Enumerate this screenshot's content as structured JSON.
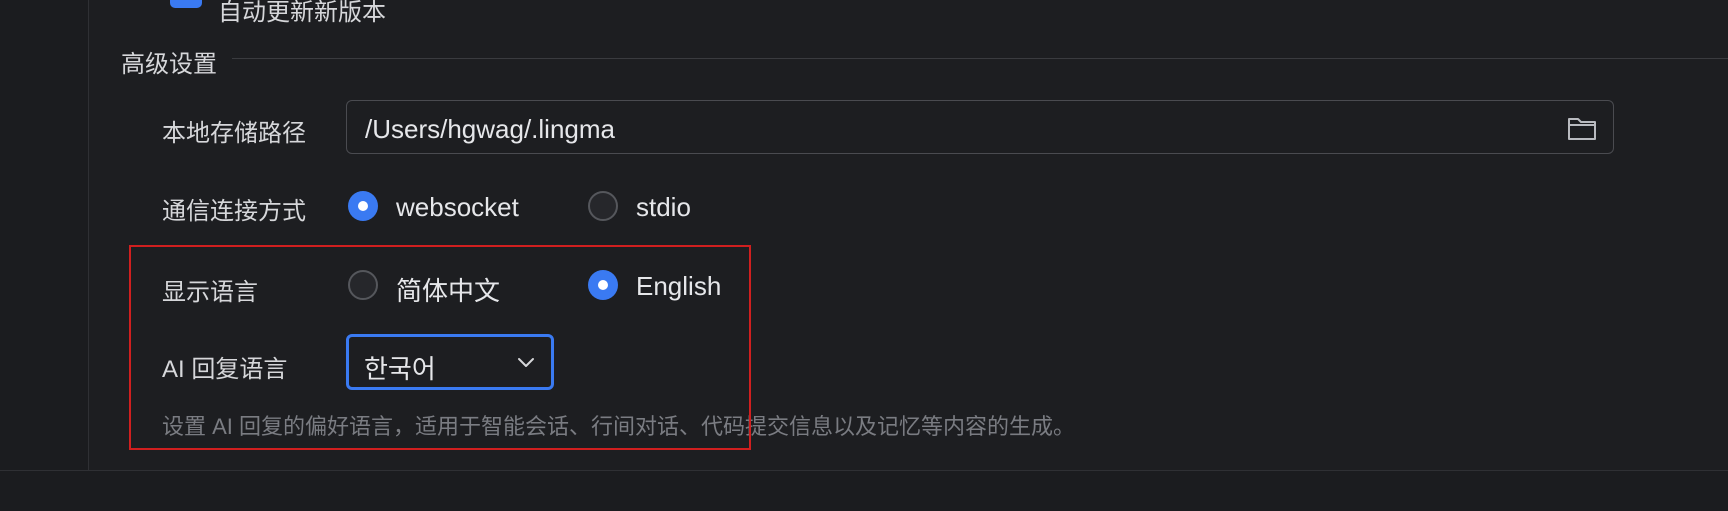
{
  "top": {
    "checkbox_label": "自动更新新版本"
  },
  "section": {
    "title": "高级设置"
  },
  "storage": {
    "label": "本地存储路径",
    "value": "/Users/hgwag/.lingma",
    "icon": "folder-icon"
  },
  "connection": {
    "label": "通信连接方式",
    "options": [
      {
        "label": "websocket",
        "selected": true
      },
      {
        "label": "stdio",
        "selected": false
      }
    ]
  },
  "display_language": {
    "label": "显示语言",
    "options": [
      {
        "label": "简体中文",
        "selected": false
      },
      {
        "label": "English",
        "selected": true
      }
    ]
  },
  "ai_language": {
    "label": "AI 回复语言",
    "value": "한국어",
    "icon": "chevron-down-icon",
    "hint": "设置 AI 回复的偏好语言，适用于智能会话、行间对话、代码提交信息以及记忆等内容的生成。"
  },
  "colors": {
    "accent": "#3a7af2",
    "highlight_border": "#d01f1f",
    "background": "#1d1e21"
  }
}
